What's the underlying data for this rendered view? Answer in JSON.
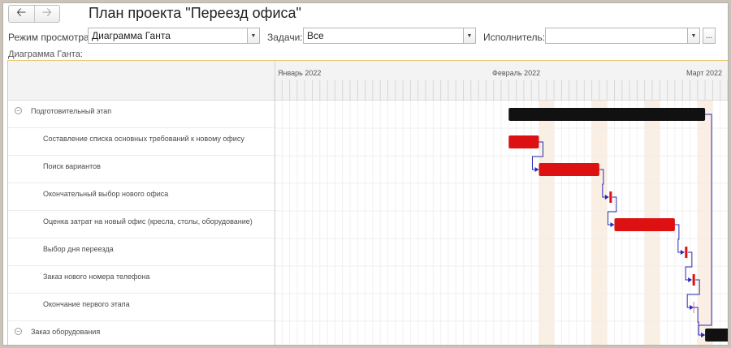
{
  "header": {
    "back_icon": "arrow-left-icon",
    "forward_icon": "arrow-right-icon",
    "title": "План проекта \"Переезд офиса\""
  },
  "filters": {
    "view_mode_label": "Режим просмотра:",
    "view_mode_value": "Диаграмма Ганта",
    "tasks_label": "Задачи:",
    "tasks_value": "Все",
    "assignee_label": "Исполнитель:",
    "assignee_value": "",
    "ellipsis": "..."
  },
  "gantt": {
    "section_label": "Диаграмма Ганта:",
    "months": [
      "Январь 2022",
      "Февраль 2022",
      "Март 2022"
    ],
    "colors": {
      "summary": "#111111",
      "task": "#dd1111",
      "link": "#2a2ab8",
      "weekend": "#fbeee2"
    },
    "tasks": [
      {
        "name": "Подготовительный этап",
        "level": 0,
        "kind": "summary",
        "start": "2022-02-01",
        "end": "2022-02-26"
      },
      {
        "name": "Составление списка основных требований к новому офису",
        "level": 1,
        "kind": "task",
        "start": "2022-02-01",
        "end": "2022-02-04"
      },
      {
        "name": "Поиск вариантов",
        "level": 1,
        "kind": "task",
        "start": "2022-02-05",
        "end": "2022-02-12"
      },
      {
        "name": "Окончательный выбор нового офиса",
        "level": 1,
        "kind": "milestone",
        "start": "2022-02-14",
        "end": "2022-02-14"
      },
      {
        "name": "Оценка затрат на новый офис (кресла, столы, оборудование)",
        "level": 1,
        "kind": "task",
        "start": "2022-02-15",
        "end": "2022-02-22"
      },
      {
        "name": "Выбор дня переезда",
        "level": 1,
        "kind": "milestone",
        "start": "2022-02-24",
        "end": "2022-02-24"
      },
      {
        "name": "Заказ нового номера телефона",
        "level": 1,
        "kind": "milestone",
        "start": "2022-02-25",
        "end": "2022-02-25"
      },
      {
        "name": "Окончание первого этапа",
        "level": 1,
        "kind": "end-marker",
        "start": "2022-02-25",
        "end": "2022-02-25"
      },
      {
        "name": "Заказ оборудования",
        "level": 0,
        "kind": "summary",
        "start": "2022-02-27",
        "end": "2022-03-08"
      }
    ]
  }
}
